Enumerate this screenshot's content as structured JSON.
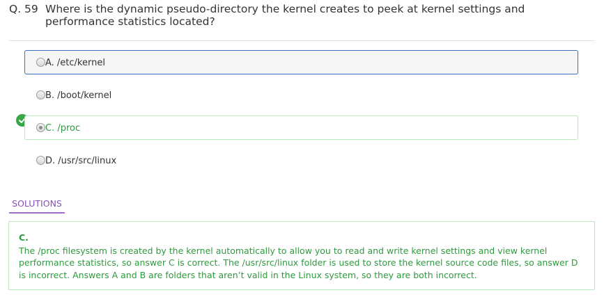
{
  "question": {
    "number": "Q. 59",
    "text": "Where is the dynamic pseudo-directory the kernel creates to peek at kernel settings and performance statistics located?"
  },
  "options": [
    {
      "label": "A. /etc/kernel"
    },
    {
      "label": "B. /boot/kernel"
    },
    {
      "label": "C. /proc"
    },
    {
      "label": "D. /usr/src/linux"
    }
  ],
  "selected_option": "C",
  "correct_option": "C",
  "solutions": {
    "tab_label": "SOLUTIONS",
    "answer": "C.",
    "explanation": "The /proc filesystem is created by the kernel automatically to allow you to read and write kernel settings and view kernel performance statistics, so answer C is correct. The /usr/src/linux folder is used to store the kernel source code files, so answer D is incorrect. Answers A and B are folders that aren’t valid in the Linux system, so they are both incorrect."
  },
  "colors": {
    "correct": "#2f9a3f",
    "correct_border": "#b8e6bf",
    "hover_border": "#3a6fc4",
    "solutions_accent": "#8a4fb5"
  },
  "icons": {
    "correct_marker": "check-circle-icon"
  }
}
